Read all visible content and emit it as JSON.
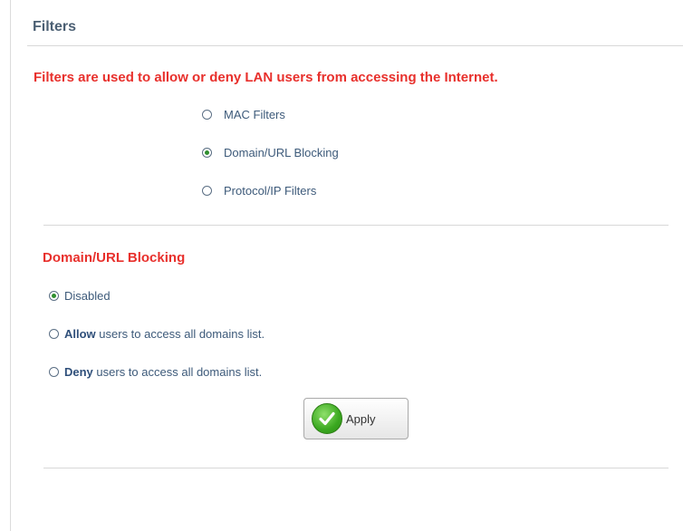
{
  "page": {
    "title": "Filters",
    "intro": "Filters are used to allow or deny LAN users from accessing the Internet."
  },
  "filter_types": {
    "selected": "Domain/URL Blocking",
    "options": [
      {
        "label": "MAC Filters",
        "checked": false
      },
      {
        "label": "Domain/URL Blocking",
        "checked": true
      },
      {
        "label": "Protocol/IP Filters",
        "checked": false
      }
    ]
  },
  "domain_blocking": {
    "title": "Domain/URL Blocking",
    "selected": "Disabled",
    "options": [
      {
        "label": "Disabled",
        "checked": true
      },
      {
        "strong": "Allow",
        "label": " users to access all domains list.",
        "checked": false
      },
      {
        "strong": "Deny",
        "label": " users to access all domains list.",
        "checked": false
      }
    ]
  },
  "apply_button": {
    "label": "Apply",
    "icon": "check-icon"
  },
  "colors": {
    "accent_red": "#e8302c",
    "title_slate": "#4b5f73",
    "label_blue": "#3d5a7a",
    "check_green": "#3aa820"
  }
}
